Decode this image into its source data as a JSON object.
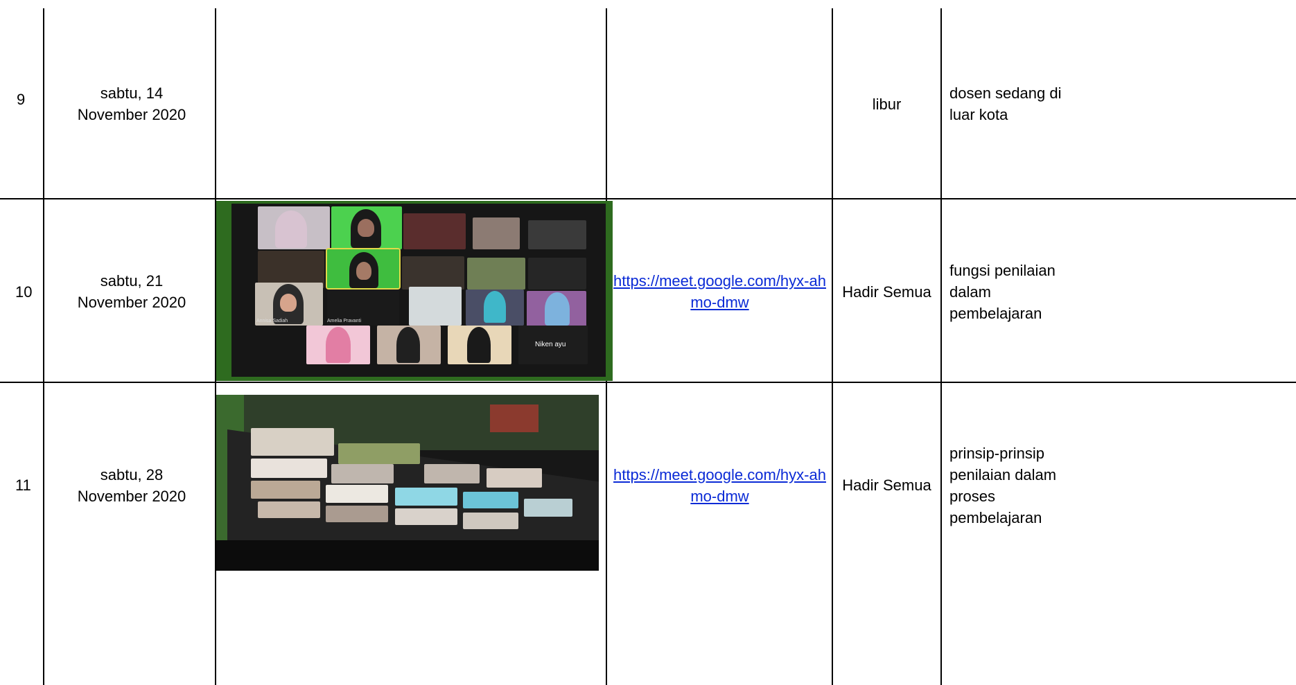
{
  "rows": [
    {
      "no": "9",
      "date": "sabtu, 14 November 2020",
      "photo": "",
      "link": "",
      "attendance": "libur",
      "topic": "dosen sedang di luar kota"
    },
    {
      "no": "10",
      "date": "sabtu, 21 November 2020",
      "photo": "zoom-screenshot-gallery",
      "link": "https://meet.google.com/hyx-ahmo-dmw",
      "attendance": "Hadir Semua",
      "topic": "fungsi penilaian dalam pembelajaran",
      "tile_names": [
        "Annisa Sadiah",
        "Amelia Pravanti",
        "Niken ayu"
      ]
    },
    {
      "no": "11",
      "date": "sabtu, 28 November 2020",
      "photo": "zoom-screenshot-angled",
      "link": "https://meet.google.com/hyx-ahmo-dmw",
      "attendance": "Hadir Semua",
      "topic": "prinsip-prinsip penilaian dalam proses pembelajaran"
    }
  ],
  "icons": {
    "photo": "image-icon"
  }
}
